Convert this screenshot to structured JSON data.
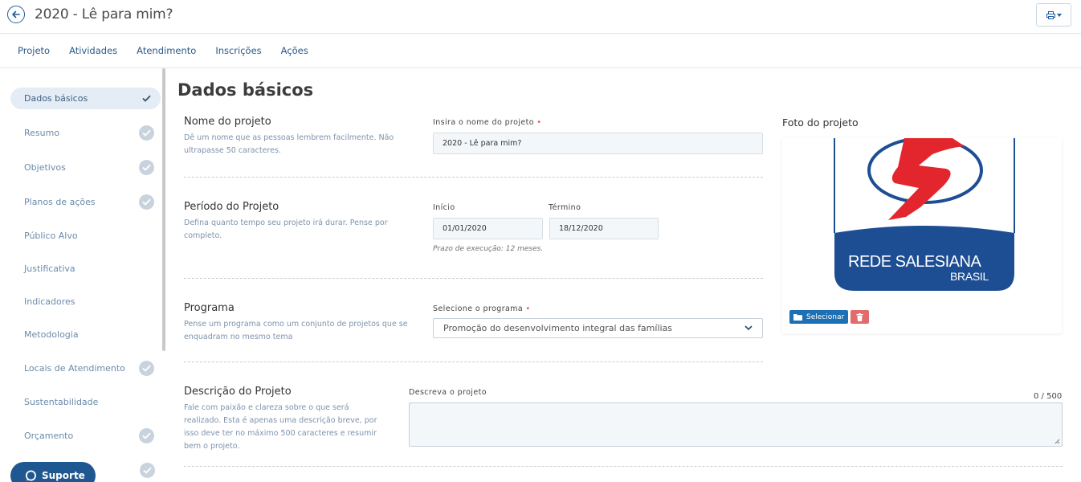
{
  "header": {
    "title": "2020 - Lê para mim?"
  },
  "tabs": [
    {
      "label": "Projeto"
    },
    {
      "label": "Atividades"
    },
    {
      "label": "Atendimento"
    },
    {
      "label": "Inscrições"
    },
    {
      "label": "Ações"
    }
  ],
  "sidebar": {
    "items": [
      {
        "label": "Dados básicos",
        "checked": true,
        "active": true
      },
      {
        "label": "Resumo",
        "checked": true
      },
      {
        "label": "Objetivos",
        "checked": true
      },
      {
        "label": "Planos de ações",
        "checked": true
      },
      {
        "label": "Público Alvo",
        "checked": false
      },
      {
        "label": "Justificativa",
        "checked": false
      },
      {
        "label": "Indicadores",
        "checked": false
      },
      {
        "label": "Metodologia",
        "checked": false
      },
      {
        "label": "Locais de Atendimento",
        "checked": true
      },
      {
        "label": "Sustentabilidade",
        "checked": false
      },
      {
        "label": "Orçamento",
        "checked": true
      }
    ],
    "support_label": "Suporte"
  },
  "main": {
    "title": "Dados básicos",
    "nome": {
      "title": "Nome do projeto",
      "desc_line1": "Dê um nome que as pessoas lembrem facilmente. Não",
      "desc_line2": "ultrapasse 50 caracteres.",
      "field_label": "Insira o nome do projeto",
      "value": "2020 - Lê para mim?"
    },
    "periodo": {
      "title": "Período do Projeto",
      "desc_line1": "Defina quanto tempo seu projeto irá durar. Pense por",
      "desc_line2": "completo.",
      "start_label": "Início",
      "start_value": "01/01/2020",
      "end_label": "Término",
      "end_value": "18/12/2020",
      "hint": "Prazo de execução: 12 meses."
    },
    "programa": {
      "title": "Programa",
      "desc_line1": "Pense um programa como um conjunto de projetos que se",
      "desc_line2": "enquadram no mesmo tema",
      "field_label": "Selecione o programa",
      "value": "Promoção do desenvolvimento integral das famílias"
    },
    "descricao": {
      "title": "Descrição do Projeto",
      "desc_line1": "Fale com paixão e clareza sobre o que será",
      "desc_line2": "realizado. Esta é apenas uma descrição breve, por",
      "desc_line3": "isso deve ter no máximo 500 caracteres e resumir",
      "desc_line4": "bem o projeto.",
      "field_label": "Descreva o projeto",
      "value": "",
      "counter": "0 / 500"
    }
  },
  "photo": {
    "title": "Foto do projeto",
    "logo_line1": "REDE SALESIANA",
    "logo_line2": "BRASIL",
    "select_label": "Selecionar"
  },
  "colors": {
    "accent": "#1f5d9c",
    "support": "#1f5790",
    "select_button": "#1f6fb5",
    "delete_button": "#e26b6b",
    "logo_blue": "#1d4e93",
    "logo_red": "#e3262d"
  }
}
